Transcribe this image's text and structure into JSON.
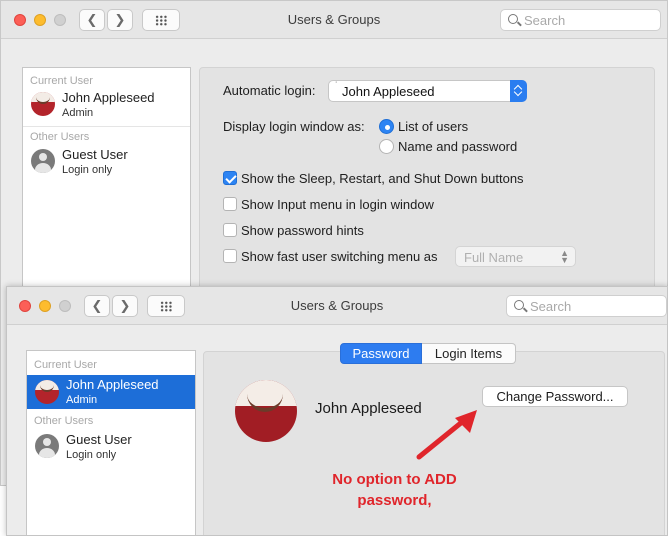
{
  "window": {
    "title": "Users & Groups",
    "search_placeholder": "Search",
    "back_glyph": "❮",
    "forward_glyph": "❯"
  },
  "sidebar": {
    "current_user_header": "Current User",
    "other_users_header": "Other Users",
    "users": [
      {
        "name": "John Appleseed",
        "role": "Admin",
        "icon": "user-avatar-icon"
      },
      {
        "name": "Guest User",
        "role": "Login only",
        "icon": "guest-user-icon"
      }
    ]
  },
  "login_options": {
    "automatic_login_label": "Automatic login:",
    "automatic_login_value": "John Appleseed",
    "display_label": "Display login window as:",
    "radio_list": "List of users",
    "radio_name": "Name and password",
    "radio_selected": "List of users",
    "checkboxes": [
      {
        "label": "Show the Sleep, Restart, and Shut Down buttons",
        "checked": true
      },
      {
        "label": "Show Input menu in login window",
        "checked": false
      },
      {
        "label": "Show password hints",
        "checked": false
      },
      {
        "label": "Show fast user switching menu as",
        "checked": false
      }
    ],
    "switch_menu_value": "Full Name"
  },
  "password_pane": {
    "tabs": [
      "Password",
      "Login Items"
    ],
    "active_tab": "Password",
    "user_name": "John Appleseed",
    "change_password_button": "Change Password...",
    "annotation": "No option to ADD password,"
  },
  "colors": {
    "accent": "#2d7cf0",
    "selection": "#1d6ed8",
    "annotation": "#e0252b"
  }
}
